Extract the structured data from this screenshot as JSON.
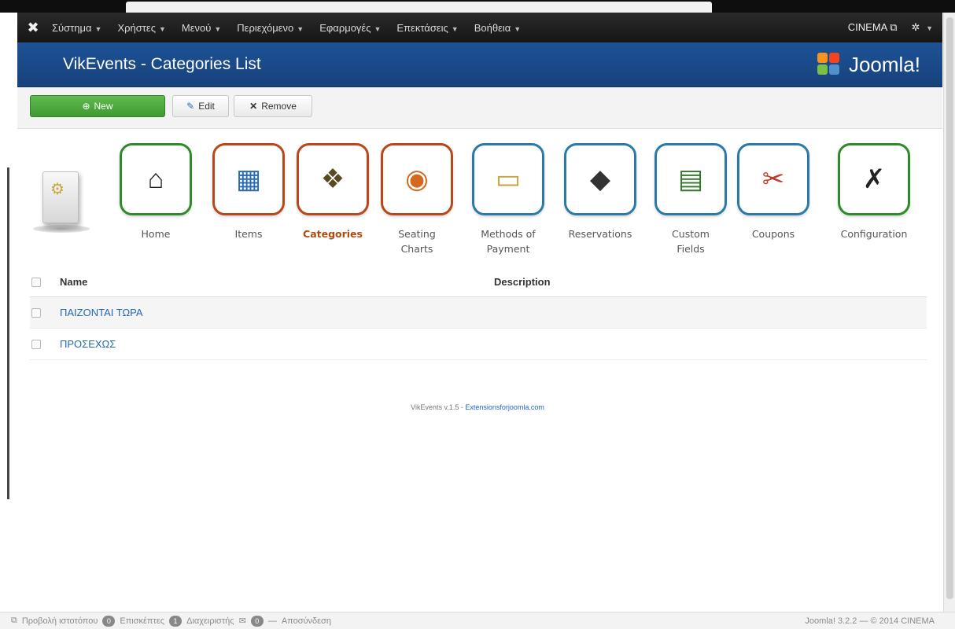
{
  "navbar": {
    "menu": [
      {
        "label": "Σύστημα"
      },
      {
        "label": "Χρήστες"
      },
      {
        "label": "Μενού"
      },
      {
        "label": "Περιεχόμενο"
      },
      {
        "label": "Εφαρμογές"
      },
      {
        "label": "Επεκτάσεις"
      },
      {
        "label": "Βοήθεια"
      }
    ],
    "site_label": "CINEMA",
    "settings_icon": "gear-icon"
  },
  "header": {
    "title": "VikEvents - Categories List",
    "brand": "Joomla!"
  },
  "toolbar": {
    "new_label": "New",
    "edit_label": "Edit",
    "remove_label": "Remove"
  },
  "vik_menu": [
    {
      "label": "Home",
      "icon": "home-icon",
      "color": "#2f8a2a"
    },
    {
      "label": "Items",
      "icon": "calendar-icon",
      "color": "#b9471a"
    },
    {
      "label": "Categories",
      "icon": "categories-icon",
      "color": "#b9471a",
      "active": true
    },
    {
      "label": "Seating Charts",
      "icon": "seating-chart-icon",
      "color": "#b9471a"
    },
    {
      "label": "Methods of Payment",
      "icon": "credit-card-icon",
      "color": "#2a7aa8"
    },
    {
      "label": "Reservations",
      "icon": "tag-icon",
      "color": "#2a7aa8"
    },
    {
      "label": "Custom Fields",
      "icon": "fields-icon",
      "color": "#2a7aa8"
    },
    {
      "label": "Coupons",
      "icon": "scissors-icon",
      "color": "#2a7aa8"
    },
    {
      "label": "Configuration",
      "icon": "tools-icon",
      "color": "#2f8a2a"
    }
  ],
  "table": {
    "columns": [
      "Name",
      "Description"
    ],
    "rows": [
      {
        "name": "ΠΑΙΖΟΝΤΑΙ ΤΩΡΑ",
        "description": ""
      },
      {
        "name": "ΠΡΟΣΕΧΩΣ",
        "description": ""
      }
    ]
  },
  "credit": {
    "text": "VikEvents v.1.5 - ",
    "link": "Extensionsforjoomla.com"
  },
  "statusbar": {
    "view_site": "Προβολή ιστοτόπου",
    "visitors_count": "0",
    "visitors_label": "Επισκέπτες",
    "admins_count": "1",
    "admins_label": "Διαχειριστής",
    "messages_count": "0",
    "logout": "Αποσύνδεση",
    "version": "Joomla! 3.2.2 — © 2014 CINEMA"
  }
}
